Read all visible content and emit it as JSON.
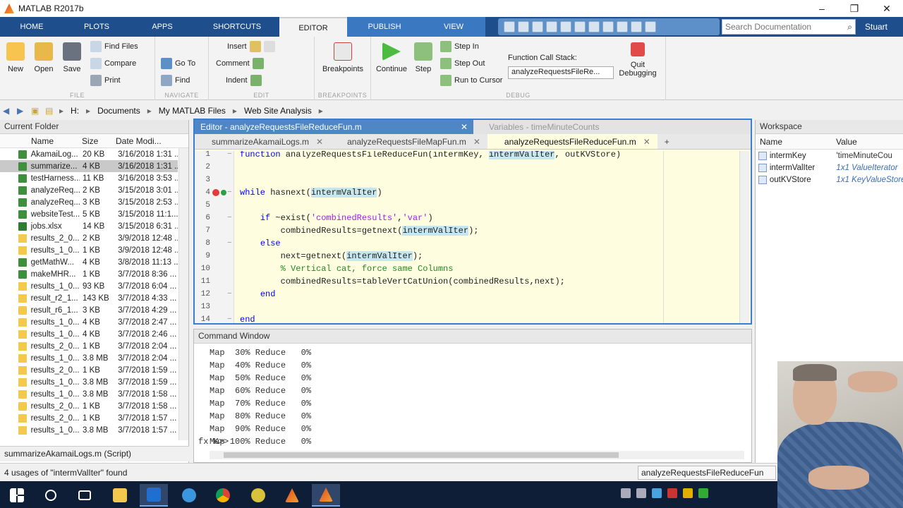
{
  "window": {
    "title": "MATLAB R2017b"
  },
  "ribbon": {
    "tabs": [
      "HOME",
      "PLOTS",
      "APPS",
      "SHORTCUTS",
      "EDITOR",
      "PUBLISH",
      "VIEW"
    ],
    "active_tab": "EDITOR",
    "search_placeholder": "Search Documentation",
    "user": "Stuart"
  },
  "toolstrip": {
    "file": {
      "name": "FILE",
      "new": "New",
      "open": "Open",
      "save": "Save",
      "find_files": "Find Files",
      "compare": "Compare",
      "print": "Print"
    },
    "navigate": {
      "name": "NAVIGATE",
      "goto": "Go To",
      "find": "Find"
    },
    "edit": {
      "name": "EDIT",
      "insert": "Insert",
      "comment": "Comment",
      "indent": "Indent"
    },
    "breakpoints": {
      "name": "BREAKPOINTS",
      "breakpoints": "Breakpoints"
    },
    "debug": {
      "name": "DEBUG",
      "continue": "Continue",
      "step": "Step",
      "step_in": "Step In",
      "step_out": "Step Out",
      "run_to_cursor": "Run to Cursor",
      "call_stack_label": "Function Call Stack:",
      "call_stack_value": "analyzeRequestsFileRe...",
      "quit": "Quit",
      "debugging": "Debugging"
    }
  },
  "address": {
    "path": [
      "H:",
      "Documents",
      "My MATLAB Files",
      "Web Site Analysis"
    ]
  },
  "current_folder": {
    "title": "Current Folder",
    "columns": [
      "Name",
      "Size",
      "Date Modi..."
    ],
    "rows": [
      {
        "name": "AkamaiLog...",
        "size": "20 KB",
        "date": "3/16/2018 1:31 ...",
        "kind": "m"
      },
      {
        "name": "summarize...",
        "size": "4 KB",
        "date": "3/16/2018 1:31 ...",
        "kind": "m"
      },
      {
        "name": "testHarness...",
        "size": "11 KB",
        "date": "3/16/2018 3:53 ...",
        "kind": "m"
      },
      {
        "name": "analyzeReq...",
        "size": "2 KB",
        "date": "3/15/2018 3:01 ...",
        "kind": "m"
      },
      {
        "name": "analyzeReq...",
        "size": "3 KB",
        "date": "3/15/2018 2:53 ...",
        "kind": "m"
      },
      {
        "name": "websiteTest...",
        "size": "5 KB",
        "date": "3/15/2018 11:1...",
        "kind": "m"
      },
      {
        "name": "jobs.xlsx",
        "size": "14 KB",
        "date": "3/15/2018 6:31 ...",
        "kind": "x"
      },
      {
        "name": "results_2_0...",
        "size": "2 KB",
        "date": "3/9/2018 12:48 ...",
        "kind": "r"
      },
      {
        "name": "results_1_0...",
        "size": "1 KB",
        "date": "3/9/2018 12:48 ...",
        "kind": "r"
      },
      {
        "name": "getMathW...",
        "size": "4 KB",
        "date": "3/8/2018 11:13 ...",
        "kind": "m"
      },
      {
        "name": "makeMHR...",
        "size": "1 KB",
        "date": "3/7/2018 8:36 ...",
        "kind": "m"
      },
      {
        "name": "results_1_0...",
        "size": "93 KB",
        "date": "3/7/2018 6:04 ...",
        "kind": "r"
      },
      {
        "name": "result_r2_1...",
        "size": "143 KB",
        "date": "3/7/2018 4:33 ...",
        "kind": "r"
      },
      {
        "name": "result_r6_1...",
        "size": "3 KB",
        "date": "3/7/2018 4:29 ...",
        "kind": "r"
      },
      {
        "name": "results_1_0...",
        "size": "4 KB",
        "date": "3/7/2018 2:47 ...",
        "kind": "r"
      },
      {
        "name": "results_1_0...",
        "size": "4 KB",
        "date": "3/7/2018 2:46 ...",
        "kind": "r"
      },
      {
        "name": "results_2_0...",
        "size": "1 KB",
        "date": "3/7/2018 2:04 ...",
        "kind": "r"
      },
      {
        "name": "results_1_0...",
        "size": "3.8 MB",
        "date": "3/7/2018 2:04 ...",
        "kind": "r"
      },
      {
        "name": "results_2_0...",
        "size": "1 KB",
        "date": "3/7/2018 1:59 ...",
        "kind": "r"
      },
      {
        "name": "results_1_0...",
        "size": "3.8 MB",
        "date": "3/7/2018 1:59 ...",
        "kind": "r"
      },
      {
        "name": "results_1_0...",
        "size": "3.8 MB",
        "date": "3/7/2018 1:58 ...",
        "kind": "r"
      },
      {
        "name": "results_2_0...",
        "size": "1 KB",
        "date": "3/7/2018 1:58 ...",
        "kind": "r"
      },
      {
        "name": "results_2_0...",
        "size": "1 KB",
        "date": "3/7/2018 1:57 ...",
        "kind": "r"
      },
      {
        "name": "results_1_0...",
        "size": "3.8 MB",
        "date": "3/7/2018 1:57 ...",
        "kind": "r"
      }
    ],
    "footer": "summarizeAkamaiLogs.m (Script)"
  },
  "editor": {
    "title": "Editor - analyzeRequestsFileReduceFun.m",
    "variables_title": "Variables - timeMinuteCounts",
    "tabs": [
      "summarizeAkamaiLogs.m",
      "analyzeRequestsFileMapFun.m",
      "analyzeRequestsFileReduceFun.m"
    ],
    "active_tab_index": 2,
    "lines": [
      {
        "n": "1",
        "html": "<span class=\"kw\">function</span> analyzeRequestsFileReduceFun(intermKey, <span class=\"hl\">intermValIter</span>, outKVStore)"
      },
      {
        "n": "2",
        "html": ""
      },
      {
        "n": "3",
        "html": ""
      },
      {
        "n": "4",
        "html": "<span class=\"kw\">while</span> hasnext(<span class=\"hl\">intermValIter</span>)",
        "bp": true
      },
      {
        "n": "5",
        "html": ""
      },
      {
        "n": "6",
        "html": "    <span class=\"kw\">if</span> ~exist(<span class=\"str\">'combinedResults'</span>,<span class=\"str\">'var'</span>)"
      },
      {
        "n": "7",
        "html": "        combinedResults=getnext(<span class=\"hl\">intermValIter</span>);"
      },
      {
        "n": "8",
        "html": "    <span class=\"kw\">else</span>"
      },
      {
        "n": "9",
        "html": "        next=getnext(<span class=\"hl\">intermValIter</span>);"
      },
      {
        "n": "10",
        "html": "        <span class=\"cm\">% Vertical cat, force same Columns</span>"
      },
      {
        "n": "11",
        "html": "        combinedResults=tableVertCatUnion(combinedResults,next);"
      },
      {
        "n": "12",
        "html": "    <span class=\"kw\">end</span>"
      },
      {
        "n": "13",
        "html": ""
      },
      {
        "n": "14",
        "html": "<span class=\"kw\">end</span>"
      }
    ]
  },
  "command_window": {
    "title": "Command Window",
    "lines": [
      "Map  30% Reduce   0%",
      "Map  40% Reduce   0%",
      "Map  50% Reduce   0%",
      "Map  60% Reduce   0%",
      "Map  70% Reduce   0%",
      "Map  80% Reduce   0%",
      "Map  90% Reduce   0%",
      "Map 100% Reduce   0%"
    ],
    "prompt": "K>>"
  },
  "workspace": {
    "title": "Workspace",
    "columns": [
      "Name",
      "Value"
    ],
    "rows": [
      {
        "name": "intermKey",
        "value": "'timeMinuteCou",
        "plain": true
      },
      {
        "name": "intermValIter",
        "value": "1x1 ValueIterator",
        "plain": false
      },
      {
        "name": "outKVStore",
        "value": "1x1 KeyValueStore",
        "plain": false
      }
    ]
  },
  "status": {
    "left": "4 usages of \"intermValIter\" found",
    "right": "analyzeRequestsFileReduceFun"
  },
  "colors": {
    "accent": "#1e4e8c",
    "editor_bg": "#fffde0",
    "highlight": "#c7e7f0"
  }
}
